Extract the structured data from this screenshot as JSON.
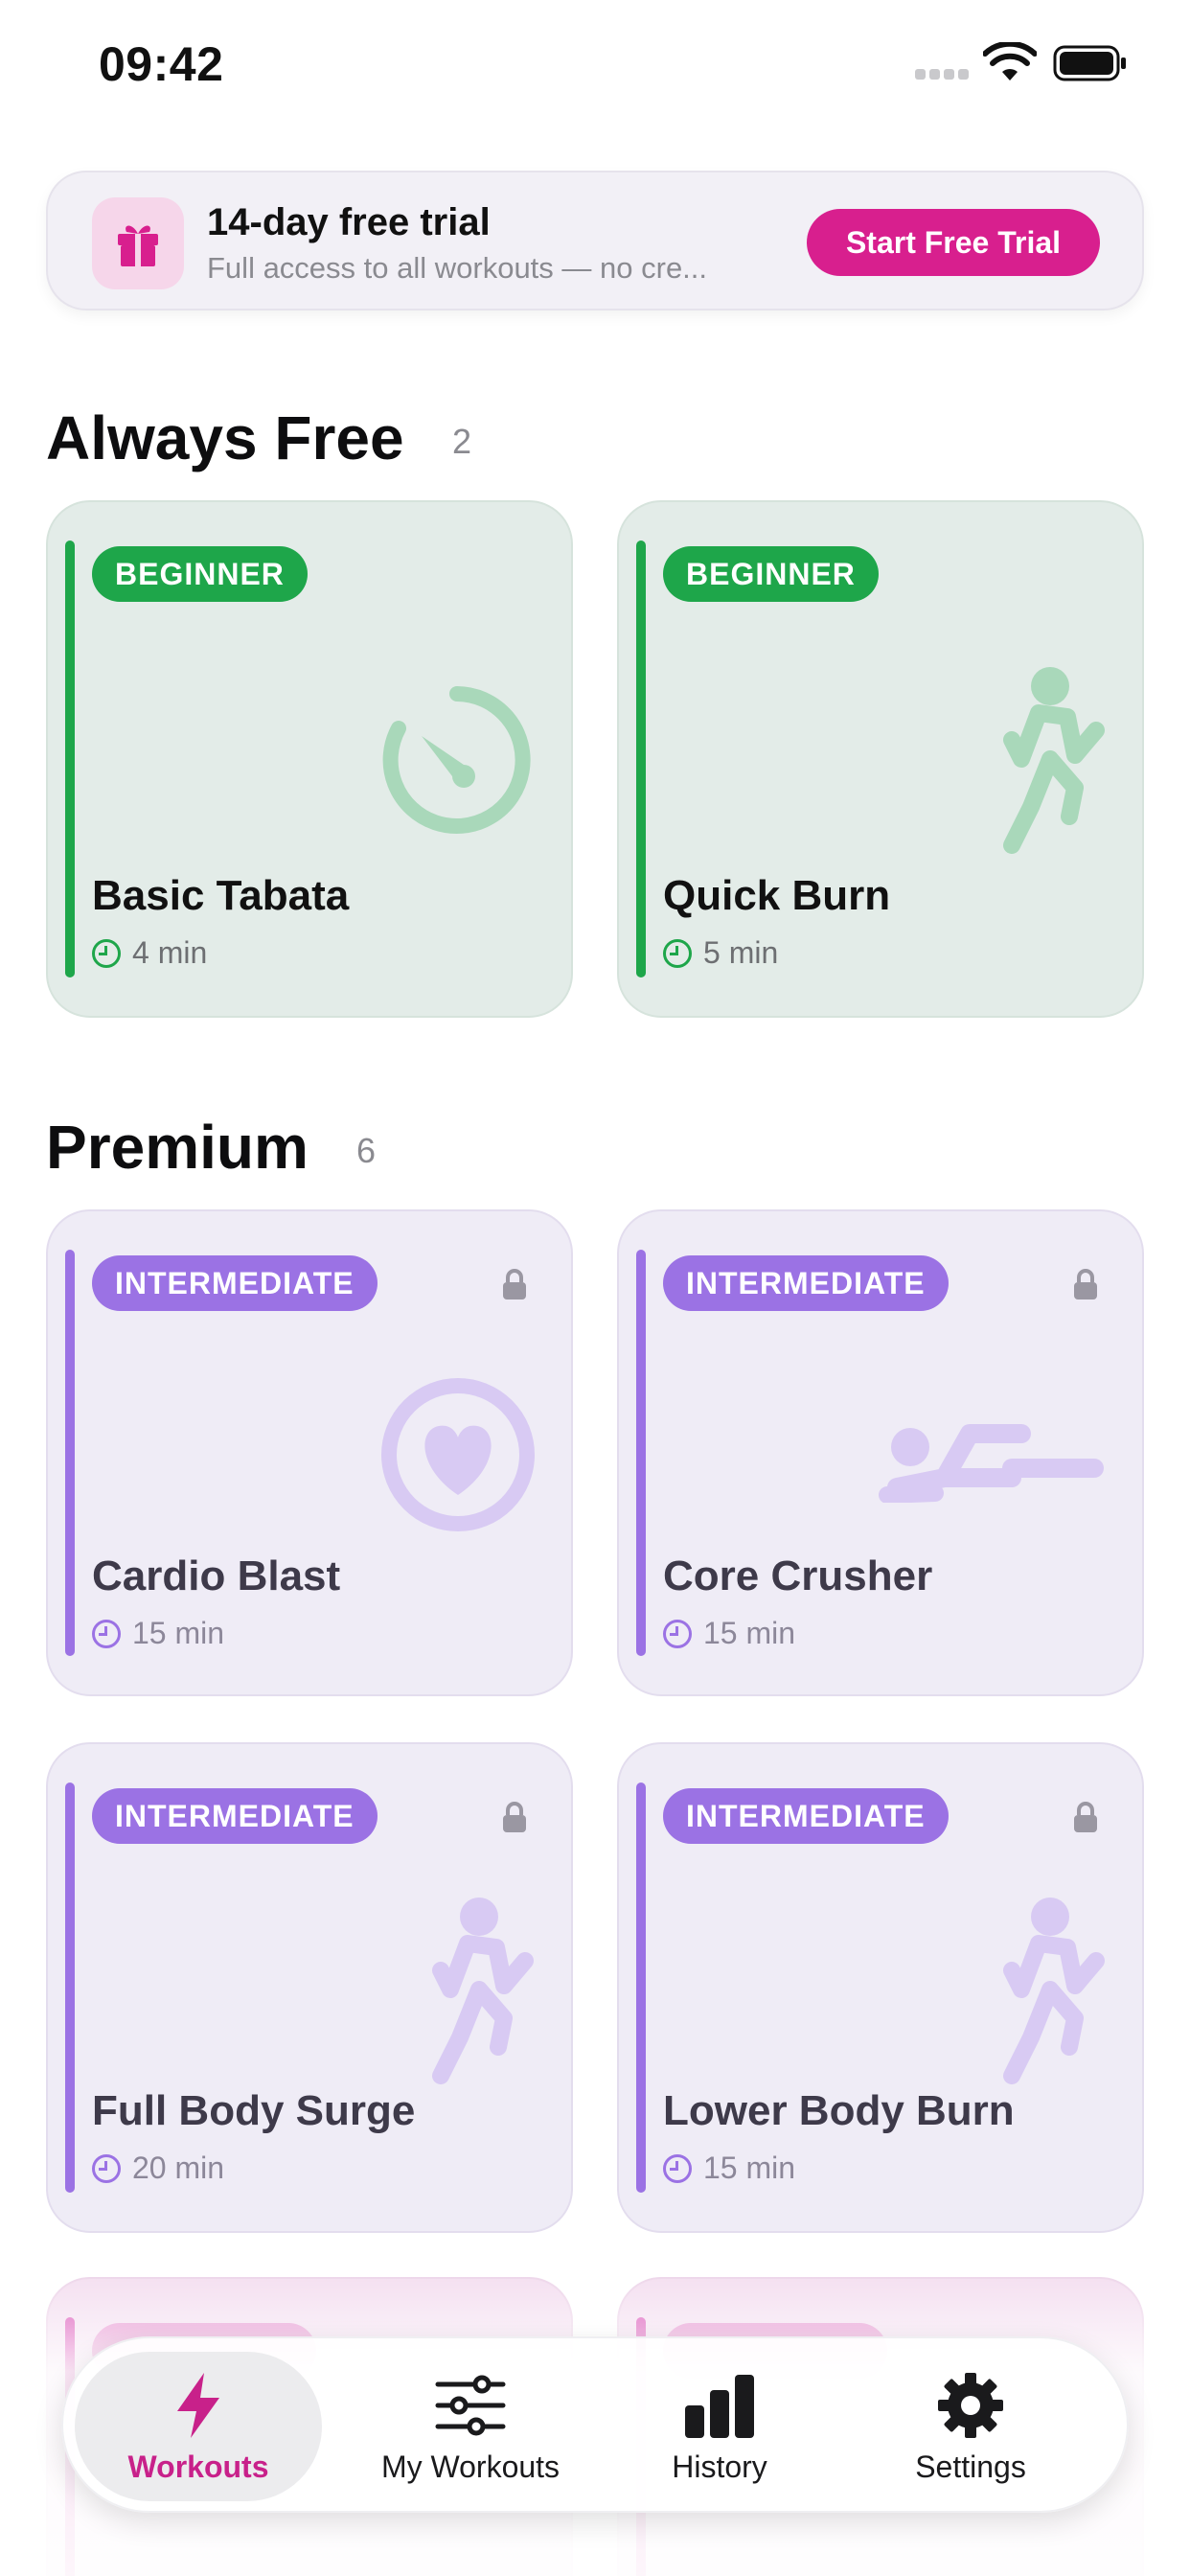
{
  "status_bar": {
    "time": "09:42"
  },
  "trial": {
    "title": "14-day free trial",
    "subtitle": "Full access to all workouts — no cre...",
    "button_label": "Start Free Trial"
  },
  "sections": {
    "free": {
      "title": "Always Free",
      "count": "2"
    },
    "premium": {
      "title": "Premium",
      "count": "6"
    }
  },
  "free_cards": [
    {
      "badge": "BEGINNER",
      "name": "Basic Tabata",
      "duration": "4 min",
      "icon": "stopwatch-icon"
    },
    {
      "badge": "BEGINNER",
      "name": "Quick Burn",
      "duration": "5 min",
      "icon": "runner-icon"
    }
  ],
  "premium_cards": [
    {
      "badge": "INTERMEDIATE",
      "name": "Cardio Blast",
      "duration": "15 min",
      "icon": "heart-icon",
      "locked": true
    },
    {
      "badge": "INTERMEDIATE",
      "name": "Core Crusher",
      "duration": "15 min",
      "icon": "plank-icon",
      "locked": true
    },
    {
      "badge": "INTERMEDIATE",
      "name": "Full Body Surge",
      "duration": "20 min",
      "icon": "runner-icon",
      "locked": true
    },
    {
      "badge": "INTERMEDIATE",
      "name": "Lower Body Burn",
      "duration": "15 min",
      "icon": "runner-icon",
      "locked": true
    }
  ],
  "tabs": [
    {
      "label": "Workouts",
      "icon": "bolt-icon",
      "active": true
    },
    {
      "label": "My Workouts",
      "icon": "sliders-icon",
      "active": false
    },
    {
      "label": "History",
      "icon": "bar-chart-icon",
      "active": false
    },
    {
      "label": "Settings",
      "icon": "gear-icon",
      "active": false
    }
  ],
  "colors": {
    "brand": "#d81f8e",
    "free_accent": "#1ea64a",
    "premium_accent": "#9b72e4"
  }
}
